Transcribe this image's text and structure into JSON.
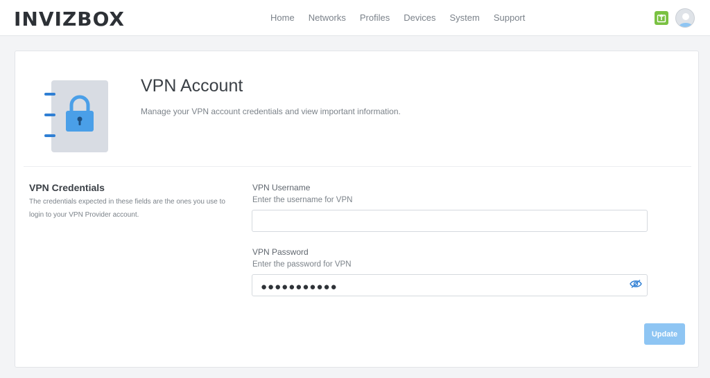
{
  "brand": {
    "logo_text": "INVIZBOX"
  },
  "nav": {
    "items": [
      {
        "label": "Home"
      },
      {
        "label": "Networks"
      },
      {
        "label": "Profiles"
      },
      {
        "label": "Devices"
      },
      {
        "label": "System"
      },
      {
        "label": "Support"
      }
    ]
  },
  "header_icons": {
    "upgrade": "upgrade-icon",
    "avatar": "user-avatar-icon"
  },
  "page": {
    "title": "VPN Account",
    "subtitle": "Manage your VPN account credentials and view important information."
  },
  "credentials": {
    "title": "VPN Credentials",
    "description": "The credentials expected in these fields are the ones you use to login to your VPN Provider account."
  },
  "form": {
    "username": {
      "label": "VPN Username",
      "hint": "Enter the username for VPN",
      "value": ""
    },
    "password": {
      "label": "VPN Password",
      "hint": "Enter the password for VPN",
      "masked_value": "●●●●●●●●●●●"
    },
    "update_label": "Update"
  },
  "colors": {
    "accent": "#8ec5f3",
    "lock": "#4a9fe8",
    "upgrade_green": "#7ac142"
  }
}
